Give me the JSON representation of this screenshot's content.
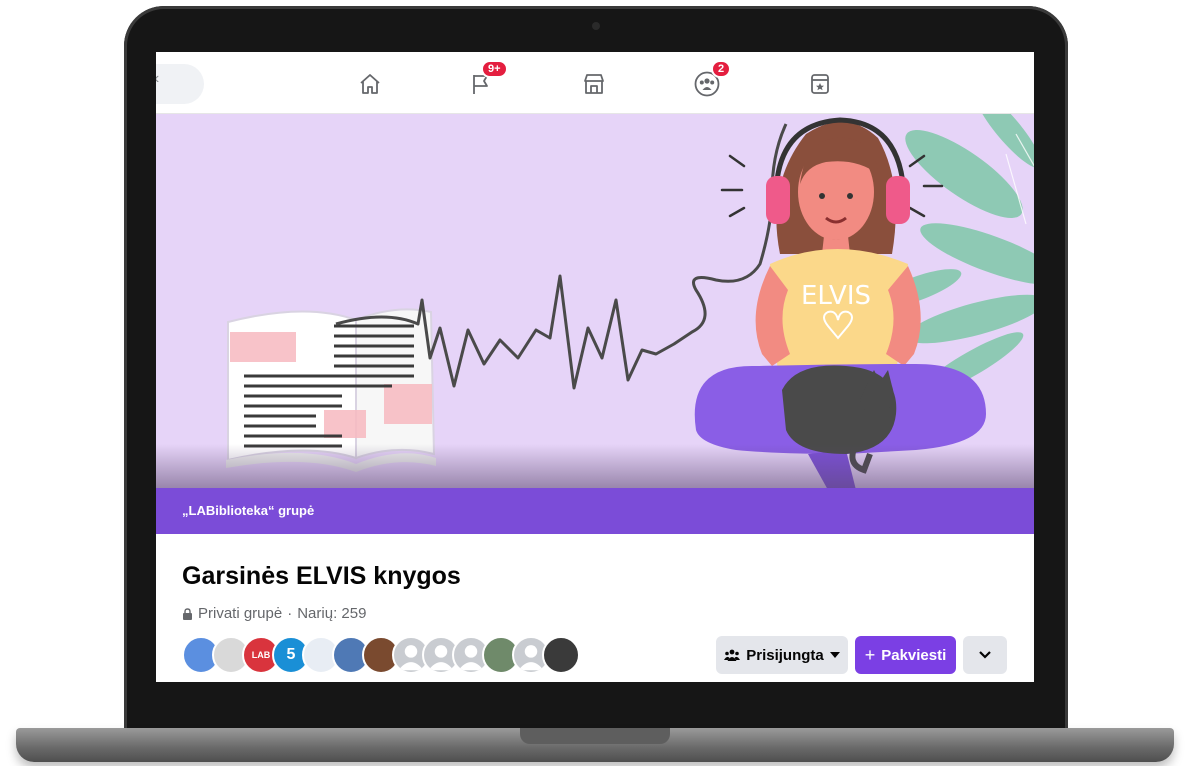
{
  "topnav": {
    "search_glyph": "‹",
    "items": [
      {
        "name": "home",
        "icon": "home-icon",
        "badge": ""
      },
      {
        "name": "pages",
        "icon": "flag-icon",
        "badge": "9+"
      },
      {
        "name": "marketplace",
        "icon": "marketplace-icon",
        "badge": ""
      },
      {
        "name": "groups",
        "icon": "groups-icon",
        "badge": "2"
      },
      {
        "name": "gaming",
        "icon": "bookmark-icon",
        "badge": ""
      }
    ]
  },
  "cover": {
    "shirt_text": "ELVIS",
    "group_label": "„LABiblioteka“ grupė",
    "colors": {
      "background": "#e6d4f8",
      "strip": "#7b4cd8",
      "pants": "#8a5ee6",
      "shirt": "#fbd88a"
    }
  },
  "group": {
    "title": "Garsinės ELVIS knygos",
    "privacy": "Privati grupė",
    "members": "Narių: 259",
    "separator": "·",
    "avatars": [
      {
        "label": "",
        "color": "#5b8fe0"
      },
      {
        "label": "",
        "color": "#d9d9d9"
      },
      {
        "label": "LAB",
        "color": "#d9343d"
      },
      {
        "label": "5",
        "color": "#1a8fd6"
      },
      {
        "label": "",
        "color": "#e8edf4"
      },
      {
        "label": "",
        "color": "#4f79b5"
      },
      {
        "label": "",
        "color": "#7a4a2f"
      },
      {
        "label": "",
        "color": "#c9ccd1"
      },
      {
        "label": "",
        "color": "#c9ccd1"
      },
      {
        "label": "",
        "color": "#c9ccd1"
      },
      {
        "label": "",
        "color": "#6f8a6a"
      },
      {
        "label": "",
        "color": "#c9ccd1"
      },
      {
        "label": "",
        "color": "#3a3a3a"
      }
    ]
  },
  "actions": {
    "joined_label": "Prisijungta",
    "invite_label": "Pakviesti",
    "invite_icon": "+",
    "more_icon": "chevron-down-icon"
  },
  "accent": "#7b3fe4"
}
